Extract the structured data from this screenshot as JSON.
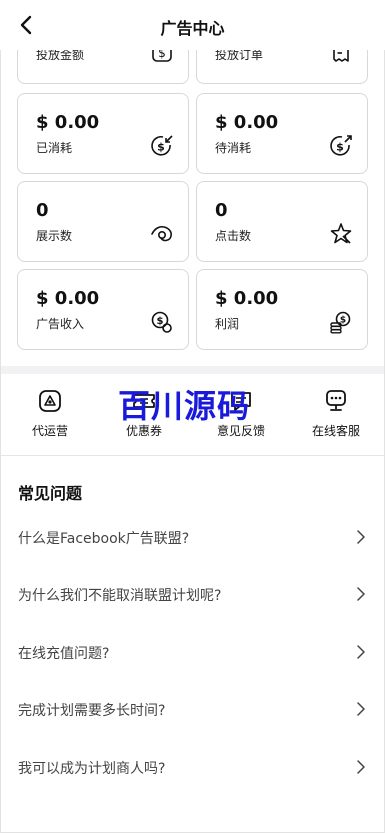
{
  "header": {
    "title": "广告中心",
    "back_icon": "chevron-left-icon"
  },
  "stats": [
    {
      "value": "",
      "label": "投放金额",
      "icon": "dollar-square-icon"
    },
    {
      "value": "",
      "label": "投放订单",
      "icon": "receipt-icon"
    },
    {
      "value": "$ 0.00",
      "label": "已消耗",
      "icon": "dollar-arrow-in-icon"
    },
    {
      "value": "$ 0.00",
      "label": "待消耗",
      "icon": "dollar-arrow-out-icon"
    },
    {
      "value": "0",
      "label": "展示数",
      "icon": "eye-icon"
    },
    {
      "value": "0",
      "label": "点击数",
      "icon": "star-click-icon"
    },
    {
      "value": "$ 0.00",
      "label": "广告收入",
      "icon": "coins-icon"
    },
    {
      "value": "$ 0.00",
      "label": "利润",
      "icon": "money-stack-icon"
    }
  ],
  "tools": [
    {
      "label": "代运营",
      "icon": "agency-icon"
    },
    {
      "label": "优惠券",
      "icon": "coupon-icon"
    },
    {
      "label": "意见反馈",
      "icon": "feedback-icon"
    },
    {
      "label": "在线客服",
      "icon": "customer-service-icon"
    }
  ],
  "watermark": "百川源码",
  "faq": {
    "title": "常见问题",
    "items": [
      "什么是Facebook广告联盟?",
      "为什么我们不能取消联盟计划呢?",
      "在线充值问题?",
      "完成计划需要多长时间?",
      "我可以成为计划商人吗?"
    ]
  },
  "colors": {
    "watermark": "#1a1adb",
    "section_gap": "#f2f2f5",
    "card_border": "#d8d8d8"
  }
}
